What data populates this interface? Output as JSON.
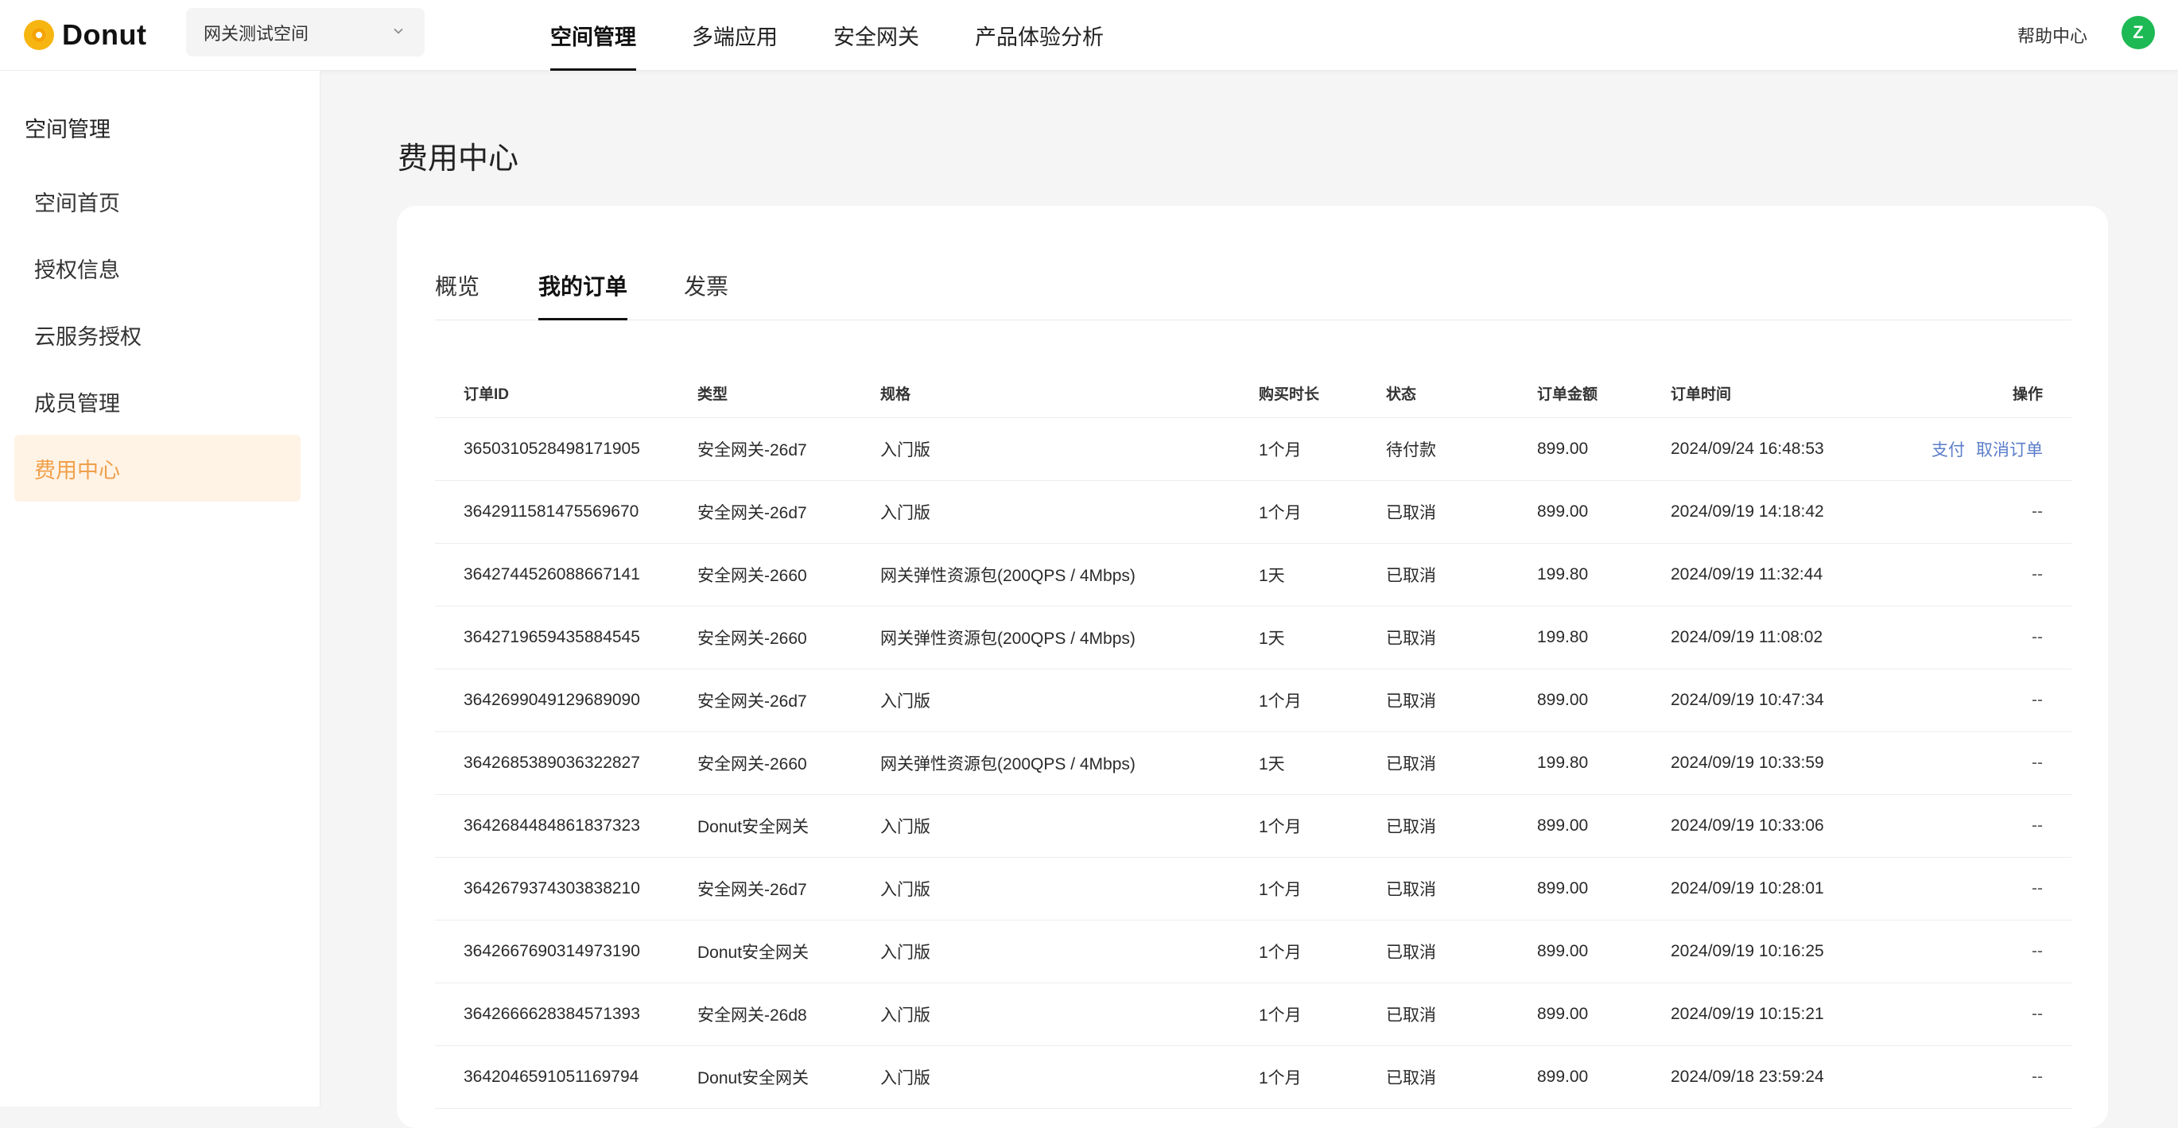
{
  "brand": {
    "name": "Donut",
    "logo_icon": "donut-logo-icon",
    "accent": "#f7b512"
  },
  "space_selector": {
    "value": "网关测试空间"
  },
  "nav": [
    {
      "label": "空间管理",
      "active": true
    },
    {
      "label": "多端应用",
      "active": false
    },
    {
      "label": "安全网关",
      "active": false
    },
    {
      "label": "产品体验分析",
      "active": false
    }
  ],
  "header": {
    "help": "帮助中心",
    "avatar_letter": "Z",
    "avatar_color": "#1db954"
  },
  "sidebar": {
    "title": "空间管理",
    "items": [
      {
        "label": "空间首页",
        "active": false
      },
      {
        "label": "授权信息",
        "active": false
      },
      {
        "label": "云服务授权",
        "active": false
      },
      {
        "label": "成员管理",
        "active": false
      },
      {
        "label": "费用中心",
        "active": true
      }
    ],
    "active_color": "#f0a04b"
  },
  "main": {
    "title": "费用中心",
    "tabs": [
      {
        "label": "概览",
        "active": false
      },
      {
        "label": "我的订单",
        "active": true
      },
      {
        "label": "发票",
        "active": false
      }
    ]
  },
  "orders": {
    "columns": [
      "订单ID",
      "类型",
      "规格",
      "购买时长",
      "状态",
      "订单金额",
      "订单时间",
      "操作"
    ],
    "rows": [
      {
        "id": "3650310528498171905",
        "type": "安全网关-26d7",
        "spec": "入门版",
        "duration": "1个月",
        "status": "待付款",
        "amount": "899.00",
        "time": "2024/09/24 16:48:53",
        "actions": [
          "支付",
          "取消订单"
        ]
      },
      {
        "id": "3642911581475569670",
        "type": "安全网关-26d7",
        "spec": "入门版",
        "duration": "1个月",
        "status": "已取消",
        "amount": "899.00",
        "time": "2024/09/19 14:18:42",
        "actions": []
      },
      {
        "id": "3642744526088667141",
        "type": "安全网关-2660",
        "spec": "网关弹性资源包(200QPS / 4Mbps)",
        "duration": "1天",
        "status": "已取消",
        "amount": "199.80",
        "time": "2024/09/19 11:32:44",
        "actions": []
      },
      {
        "id": "3642719659435884545",
        "type": "安全网关-2660",
        "spec": "网关弹性资源包(200QPS / 4Mbps)",
        "duration": "1天",
        "status": "已取消",
        "amount": "199.80",
        "time": "2024/09/19 11:08:02",
        "actions": []
      },
      {
        "id": "3642699049129689090",
        "type": "安全网关-26d7",
        "spec": "入门版",
        "duration": "1个月",
        "status": "已取消",
        "amount": "899.00",
        "time": "2024/09/19 10:47:34",
        "actions": []
      },
      {
        "id": "3642685389036322827",
        "type": "安全网关-2660",
        "spec": "网关弹性资源包(200QPS / 4Mbps)",
        "duration": "1天",
        "status": "已取消",
        "amount": "199.80",
        "time": "2024/09/19 10:33:59",
        "actions": []
      },
      {
        "id": "3642684484861837323",
        "type": "Donut安全网关",
        "spec": "入门版",
        "duration": "1个月",
        "status": "已取消",
        "amount": "899.00",
        "time": "2024/09/19 10:33:06",
        "actions": []
      },
      {
        "id": "3642679374303838210",
        "type": "安全网关-26d7",
        "spec": "入门版",
        "duration": "1个月",
        "status": "已取消",
        "amount": "899.00",
        "time": "2024/09/19 10:28:01",
        "actions": []
      },
      {
        "id": "3642667690314973190",
        "type": "Donut安全网关",
        "spec": "入门版",
        "duration": "1个月",
        "status": "已取消",
        "amount": "899.00",
        "time": "2024/09/19 10:16:25",
        "actions": []
      },
      {
        "id": "3642666628384571393",
        "type": "安全网关-26d8",
        "spec": "入门版",
        "duration": "1个月",
        "status": "已取消",
        "amount": "899.00",
        "time": "2024/09/19 10:15:21",
        "actions": []
      },
      {
        "id": "3642046591051169794",
        "type": "Donut安全网关",
        "spec": "入门版",
        "duration": "1个月",
        "status": "已取消",
        "amount": "899.00",
        "time": "2024/09/18 23:59:24",
        "actions": []
      }
    ],
    "no_action_text": "--",
    "link_color": "#5b7ec9"
  }
}
